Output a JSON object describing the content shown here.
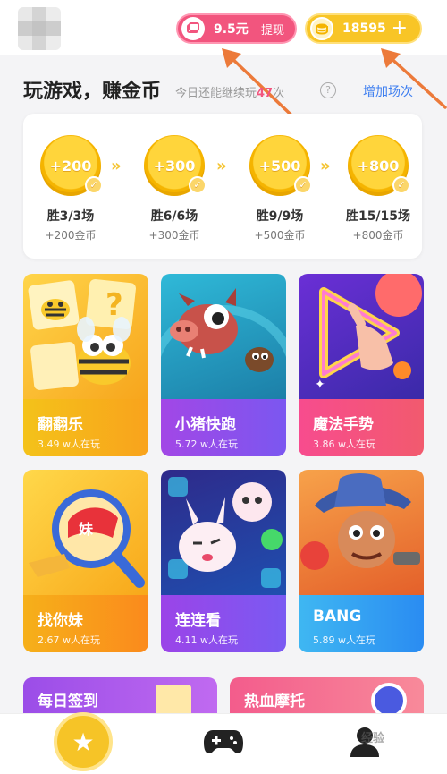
{
  "header": {
    "cash": {
      "amount": "9.5元",
      "action": "提现"
    },
    "coins": {
      "amount": "18595",
      "action": "+"
    }
  },
  "section": {
    "title": "玩游戏，赚金币",
    "remain_prefix": "今日还能继续玩",
    "remain_count": "47",
    "remain_suffix": "次",
    "help": "?",
    "add_label": "增加场次"
  },
  "milestones": [
    {
      "reward": "+200",
      "title": "胜3/3场",
      "sub": "+200金币"
    },
    {
      "reward": "+300",
      "title": "胜6/6场",
      "sub": "+300金币"
    },
    {
      "reward": "+500",
      "title": "胜9/9场",
      "sub": "+500金币"
    },
    {
      "reward": "+800",
      "title": "胜15/15场",
      "sub": "+800金币"
    }
  ],
  "games": [
    {
      "name": "翻翻乐",
      "players": "3.49 w人在玩"
    },
    {
      "name": "小猪快跑",
      "players": "5.72 w人在玩"
    },
    {
      "name": "魔法手势",
      "players": "3.86 w人在玩"
    },
    {
      "name": "找你妹",
      "players": "2.67 w人在玩"
    },
    {
      "name": "连连看",
      "players": "4.11 w人在玩"
    },
    {
      "name": "BANG",
      "players": "5.89 w人在玩"
    }
  ],
  "promos": [
    {
      "label": "每日签到"
    },
    {
      "label": "热血摩托"
    }
  ],
  "colors": {
    "cash_pill": "#f2557e",
    "coin_pill": "#f8c526",
    "link": "#3f7ff0",
    "highlight": "#f2557e",
    "arrow": "#ec7a3a"
  },
  "icons": {
    "cash": "cash-stack-icon",
    "coins": "coin-stack-icon",
    "home": "star-icon",
    "game": "gamepad-icon",
    "user": "user-icon"
  },
  "watermark": "经验"
}
